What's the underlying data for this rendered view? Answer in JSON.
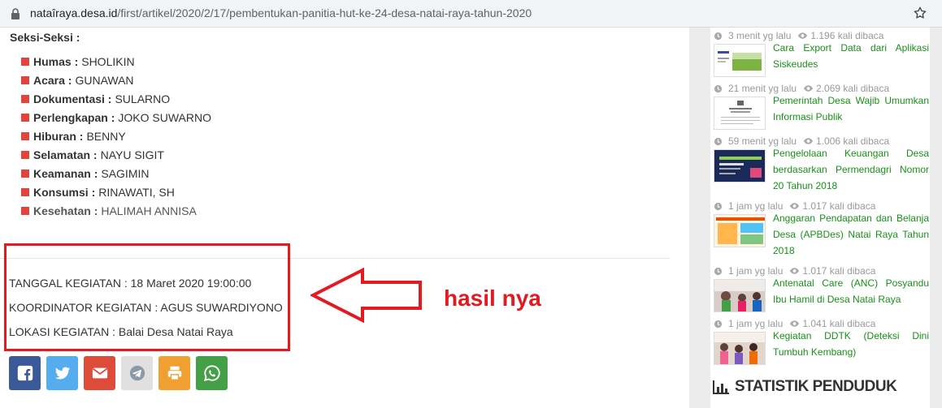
{
  "browser": {
    "url_host": "nataîraya.desa.id",
    "url_path": "/first/artikel/2020/2/17/pembentukan-panitia-hut-ke-24-desa-natai-raya-tahun-2020"
  },
  "article": {
    "section_title": "Seksi-Seksi :",
    "seksi": [
      {
        "role": "Humas :",
        "name": "SHOLIKIN"
      },
      {
        "role": "Acara :",
        "name": "GUNAWAN"
      },
      {
        "role": "Dokumentasi :",
        "name": "SULARNO"
      },
      {
        "role": "Perlengkapan :",
        "name": "JOKO SUWARNO"
      },
      {
        "role": "Hiburan :",
        "name": "BENNY"
      },
      {
        "role": "Selamatan :",
        "name": "NAYU SIGIT"
      },
      {
        "role": "Keamanan :",
        "name": "SAGIMIN"
      },
      {
        "role": "Konsumsi :",
        "name": "RINAWATI, SH"
      },
      {
        "role": "Kesehatan :",
        "name": "HALIMAH ANNISA"
      }
    ],
    "tanggal": "TANGGAL KEGIATAN : 18 Maret 2020 19:00:00",
    "koordinator": "KOORDINATOR KEGIATAN : AGUS SUWARDIYONO",
    "lokasi": "LOKASI KEGIATAN : Balai Desa Natai Raya"
  },
  "annotation": {
    "label": "hasil nya",
    "color": "#e01b22"
  },
  "share_buttons": [
    {
      "icon": "facebook-icon",
      "color": "#3b5998"
    },
    {
      "icon": "twitter-icon",
      "color": "#55acee"
    },
    {
      "icon": "email-icon",
      "color": "#dd4b39"
    },
    {
      "icon": "telegram-icon",
      "color": "#e0e0e0"
    },
    {
      "icon": "print-icon",
      "color": "#f0a030"
    },
    {
      "icon": "whatsapp-icon",
      "color": "#43a047"
    }
  ],
  "sidebar": {
    "articles": [
      {
        "time": "3 menit yg lalu",
        "views": "1.196 kali dibaca",
        "title": "Cara Export Data dari Aplikasi Siskeudes"
      },
      {
        "time": "21 menit yg lalu",
        "views": "2.069 kali dibaca",
        "title": "Pemerintah Desa Wajib Umumkan Informasi Publik"
      },
      {
        "time": "59 menit yg lalu",
        "views": "1.006 kali dibaca",
        "title": "Pengelolaan Keuangan Desa berdasarkan Permendagri Nomor 20 Tahun 2018"
      },
      {
        "time": "1 jam yg lalu",
        "views": "1.017 kali dibaca",
        "title": "Anggaran Pendapatan dan Belanja Desa (APBDes) Natai Raya Tahun 2018"
      },
      {
        "time": "1 jam yg lalu",
        "views": "1.017 kali dibaca",
        "title": "Antenatal Care (ANC) Posyandu Ibu Hamil di Desa Natai Raya"
      },
      {
        "time": "1 jam yg lalu",
        "views": "1.041 kali dibaca",
        "title": "Kegiatan DDTK (Deteksi Dini Tumbuh Kembang)"
      }
    ],
    "stat_heading": "STATISTIK PENDUDUK"
  }
}
